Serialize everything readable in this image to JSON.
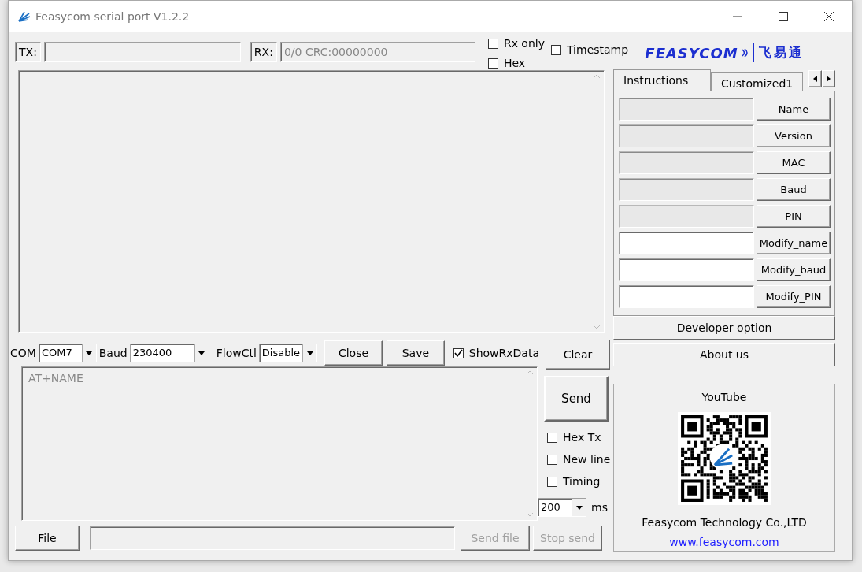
{
  "window": {
    "title": "Feasycom serial port V1.2.2"
  },
  "tx": {
    "label": "TX:"
  },
  "rx": {
    "label": "RX:",
    "value": "0/0 CRC:00000000"
  },
  "options": [
    {
      "label": "Rx only",
      "checked": false
    },
    {
      "label": "Hex",
      "checked": false
    },
    {
      "label": "Timestamp",
      "checked": false
    }
  ],
  "selectors": [
    {
      "label": "COM",
      "value": "COM7"
    },
    {
      "label": "Baud",
      "value": "230400"
    },
    {
      "label": "FlowCtl",
      "value": "Disable"
    }
  ],
  "buttons": [
    "Close",
    "Save"
  ],
  "show_rx": {
    "label": "ShowRxData",
    "checked": true
  },
  "clear": "Clear",
  "send_text": "AT+NAME",
  "send": "Send",
  "send_options": [
    {
      "label": "Hex Tx",
      "checked": false
    },
    {
      "label": "New line",
      "checked": false
    },
    {
      "label": "Timing",
      "checked": false
    }
  ],
  "interval": {
    "value": "200",
    "unit": "ms"
  },
  "file": {
    "button": "File",
    "actions": [
      {
        "label": "Send file",
        "disabled": true
      },
      {
        "label": "Stop send",
        "disabled": true
      }
    ]
  },
  "logo": {
    "brand": "FEASYCOM",
    "local": "飞易通"
  },
  "tabs": [
    {
      "label": "Instructions",
      "selected": true
    },
    {
      "label": "Customized1",
      "selected": false
    }
  ],
  "commands": [
    {
      "button": "Name",
      "disabled": true
    },
    {
      "button": "Version",
      "disabled": true
    },
    {
      "button": "MAC",
      "disabled": true
    },
    {
      "button": "Baud",
      "disabled": true
    },
    {
      "button": "PIN",
      "disabled": true
    },
    {
      "button": "Modify_name",
      "disabled": false
    },
    {
      "button": "Modify_baud",
      "disabled": false
    },
    {
      "button": "Modify_PIN",
      "disabled": false
    }
  ],
  "developer": "Developer option",
  "about": "About us",
  "promo": {
    "title": "YouTube",
    "company": "Feasycom Technology Co.,LTD",
    "link": "www.feasycom.com"
  }
}
